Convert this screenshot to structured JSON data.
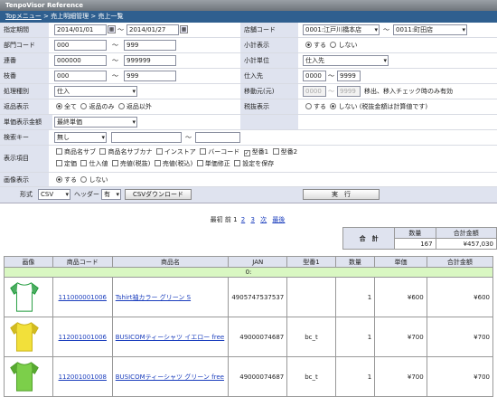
{
  "header": {
    "title": "TenpoVisor Reference"
  },
  "breadcrumb": {
    "home": "Topメニュー",
    "sep1": " > ",
    "item1": "売上明細管理",
    "sep2": " > ",
    "item2": "売上一覧"
  },
  "form": {
    "period": {
      "label": "指定期間",
      "from": "2014/01/01",
      "to": "2014/01/27",
      "tilde": "～"
    },
    "store": {
      "label": "店舗コード",
      "from": "0001:江戸川橋本店",
      "to": "0011:町田店",
      "tilde": "～"
    },
    "dept": {
      "label": "部門コード",
      "from": "000",
      "to": "999",
      "tilde": "～"
    },
    "subtotal_disp": {
      "label": "小計表示",
      "opt1": "する",
      "opt2": "しない"
    },
    "serial": {
      "label": "連番",
      "from": "000000",
      "to": "999999",
      "tilde": "～"
    },
    "subtotal_unit": {
      "label": "小計単位",
      "value": "仕入先"
    },
    "branch": {
      "label": "枝番",
      "from": "000",
      "to": "999",
      "tilde": "～"
    },
    "supplier": {
      "label": "仕入先",
      "from": "0000",
      "to": "9999",
      "tilde": "～"
    },
    "proc_type": {
      "label": "処理種別",
      "value": "仕入"
    },
    "moved": {
      "label": "移動元(元)",
      "from": "0000",
      "to": "9999",
      "tilde": "～",
      "note": "移出、移入チェック時のみ有効"
    },
    "returns": {
      "label": "返品表示",
      "opt1": "全て",
      "opt2": "返品のみ",
      "opt3": "返品以外"
    },
    "tax": {
      "label": "税抜表示",
      "opt1": "する",
      "opt2": "しない",
      "note": "(税抜金額は計算値です)"
    },
    "unit_price": {
      "label": "単価表示金額",
      "value": "最終単価"
    },
    "keyword": {
      "label": "検索キー",
      "value": "無し",
      "tilde": "～"
    },
    "display_items": {
      "label": "表示項目",
      "items1": [
        "商品名サブ",
        "商品名サブカナ",
        "インストア",
        "バーコード",
        "型番1",
        "型番2"
      ],
      "items2": [
        "定価",
        "仕入値",
        "売値(税抜)",
        "売値(税込)",
        "単価修正",
        "設定を保存"
      ]
    },
    "image": {
      "label": "画像表示",
      "opt1": "する",
      "opt2": "しない"
    },
    "bottom": {
      "format_label": "形式",
      "format_value": "CSV",
      "header_label": "ヘッダー",
      "header_value": "有",
      "csv_button": "CSVダウンロード",
      "exec_button": "実　行"
    }
  },
  "pager": {
    "first": "最初",
    "prev": "前",
    "p1": "1",
    "p2": "2",
    "p3": "3",
    "next": "次",
    "last": "最後"
  },
  "totals": {
    "label": "合　計",
    "qty_header": "数量",
    "amount_header": "合計金額",
    "qty": "167",
    "amount": "¥457,030"
  },
  "table": {
    "headers": [
      "画像",
      "商品コード",
      "商品名",
      "JAN",
      "型番1",
      "数量",
      "単価",
      "合計金額"
    ],
    "group": "0:",
    "rows": [
      {
        "code": "111000001006",
        "name": "Tshirt袖カラー グリーン S",
        "jan": "4905747537537",
        "model": "",
        "qty": "1",
        "price": "¥600",
        "total": "¥600",
        "color": "#ffffff",
        "accent": "#1e9a3a"
      },
      {
        "code": "112001001006",
        "name": "BUSICOMティーシャツ イエロー free",
        "jan": "49000074687",
        "model": "bc_t",
        "qty": "1",
        "price": "¥700",
        "total": "¥700",
        "color": "#f2e03a",
        "accent": "#c9b21a"
      },
      {
        "code": "112001001008",
        "name": "BUSICOMティーシャツ グリーン free",
        "jan": "49000074687",
        "model": "bc_t",
        "qty": "1",
        "price": "¥700",
        "total": "¥700",
        "color": "#7ccf4a",
        "accent": "#4f9f2a"
      }
    ]
  }
}
